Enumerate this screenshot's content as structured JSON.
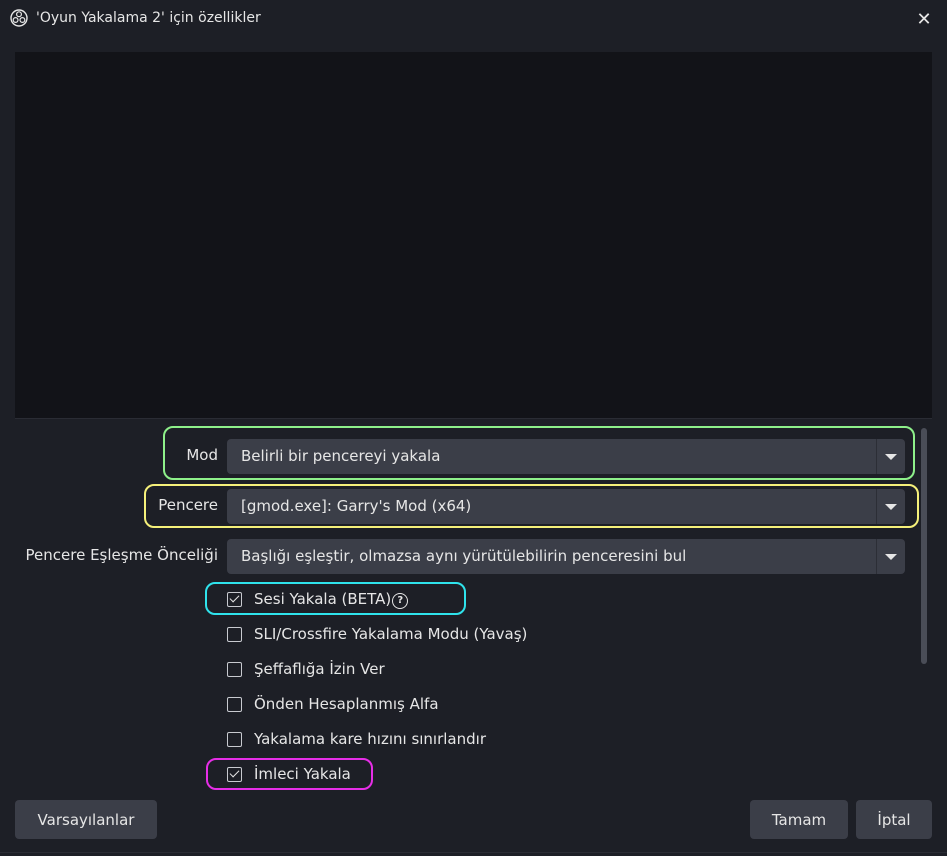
{
  "window": {
    "title": "'Oyun Yakalama 2' için özellikler",
    "close_glyph": "✕"
  },
  "properties": {
    "mode": {
      "label": "Mod",
      "value": "Belirli bir pencereyi yakala"
    },
    "window_select": {
      "label": "Pencere",
      "value": "[gmod.exe]: Garry's Mod (x64)"
    },
    "match_priority": {
      "label": "Pencere Eşleşme Önceliği",
      "value": "Başlığı eşleştir, olmazsa aynı yürütülebilirin penceresini bul"
    },
    "checkboxes": [
      {
        "label": "Sesi Yakala (BETA)",
        "checked": true
      },
      {
        "label": "SLI/Crossfire Yakalama Modu (Yavaş)",
        "checked": false
      },
      {
        "label": "Şeffaflığa İzin Ver",
        "checked": false
      },
      {
        "label": "Önden Hesaplanmış Alfa",
        "checked": false
      },
      {
        "label": "Yakalama kare hızını sınırlandır",
        "checked": false
      },
      {
        "label": "İmleci Yakala",
        "checked": true
      }
    ],
    "help_glyph": "?"
  },
  "buttons": {
    "defaults": "Varsayılanlar",
    "ok": "Tamam",
    "cancel": "İptal"
  },
  "highlight_colors": {
    "mode": "#8ef08a",
    "window": "#f5f07a",
    "audio": "#2fe3ec",
    "cursor": "#e62ee6"
  }
}
